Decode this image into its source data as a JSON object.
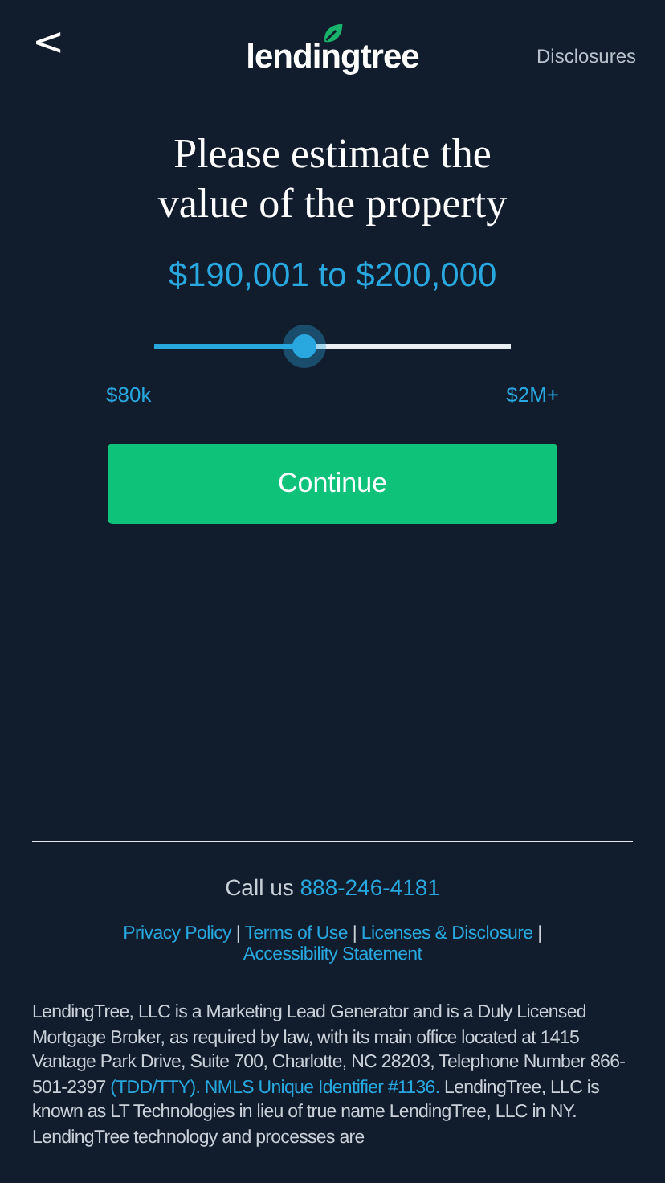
{
  "header": {
    "back_icon": "<",
    "logo": "lendingtree",
    "disclosures": "Disclosures"
  },
  "question": "Please estimate the value of the property",
  "slider": {
    "reading": "$190,001 to $200,000",
    "level": 0.42,
    "min_label": "$80k",
    "max_label": "$2M+"
  },
  "continue_button": "Continue",
  "footer": {
    "call_label": "Call us",
    "phone": "888-246-4181",
    "links": [
      "Privacy Policy",
      "Terms of Use",
      "Licenses & Disclosure",
      "Accessibility Statement"
    ],
    "separator": "|",
    "disclaimer": {
      "before": "LendingTree, LLC is a Marketing Lead Generator and is a Duly Licensed Mortgage Broker, as required by law, with its main office located at 1415 Vantage Park Drive, Suite 700, Charlotte, NC 28203, Telephone Number 866-501-2397 ",
      "link": "(TDD/TTY). NMLS Unique Identifier #1136.",
      "after": " LendingTree, LLC is known as LT Technologies in lieu of true name LendingTree, LLC in NY. LendingTree technology and processes are"
    }
  }
}
